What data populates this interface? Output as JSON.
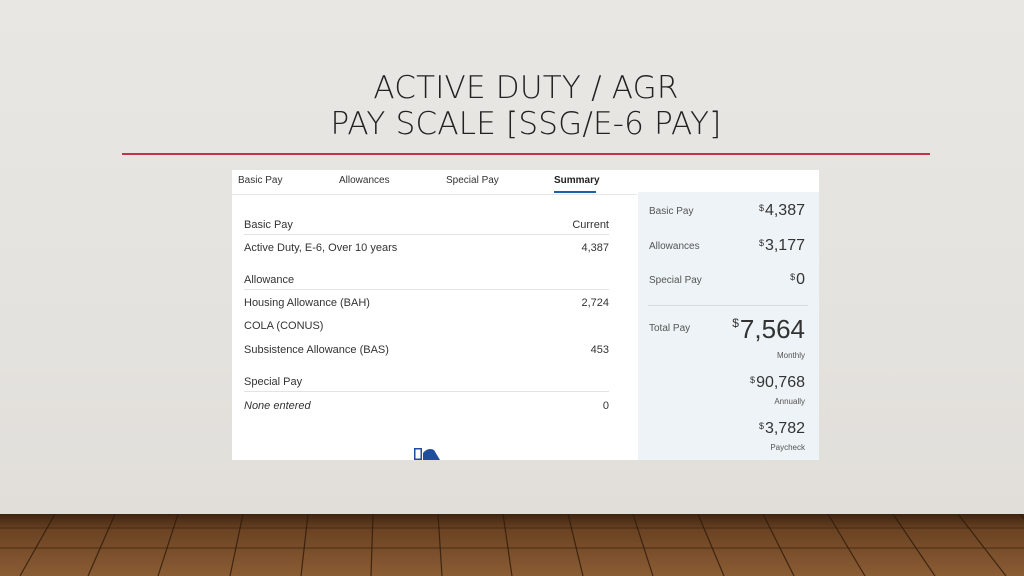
{
  "slide": {
    "title_line1": "ACTIVE DUTY / AGR",
    "title_line2": "PAY SCALE [SSG/E-6 PAY]",
    "accent_color": "#c0334a"
  },
  "tabs": [
    {
      "label": "Basic Pay"
    },
    {
      "label": "Allowances"
    },
    {
      "label": "Special Pay"
    },
    {
      "label": "Summary",
      "active": true
    }
  ],
  "detail": {
    "basic_header": "Basic Pay",
    "current_header": "Current",
    "basic_row": {
      "label": "Active Duty, E-6, Over 10 years",
      "value": "4,387"
    },
    "allowance_header": "Allowance",
    "bah": {
      "label": "Housing Allowance (BAH)",
      "value": "2,724"
    },
    "cola": {
      "label": "COLA (CONUS)",
      "value": ""
    },
    "bas": {
      "label": "Subsistence Allowance (BAS)",
      "value": "453"
    },
    "special_header": "Special Pay",
    "none_row": {
      "label": "None entered",
      "value": "0"
    }
  },
  "summary": {
    "currency": "$",
    "basic": {
      "label": "Basic Pay",
      "amount": "4,387"
    },
    "allowances": {
      "label": "Allowances",
      "amount": "3,177"
    },
    "special": {
      "label": "Special Pay",
      "amount": "0"
    },
    "total": {
      "label": "Total Pay",
      "amount": "7,564",
      "period": "Monthly"
    },
    "annual": {
      "amount": "90,768",
      "period": "Annually"
    },
    "paycheck": {
      "amount": "3,782",
      "period": "Paycheck"
    }
  }
}
